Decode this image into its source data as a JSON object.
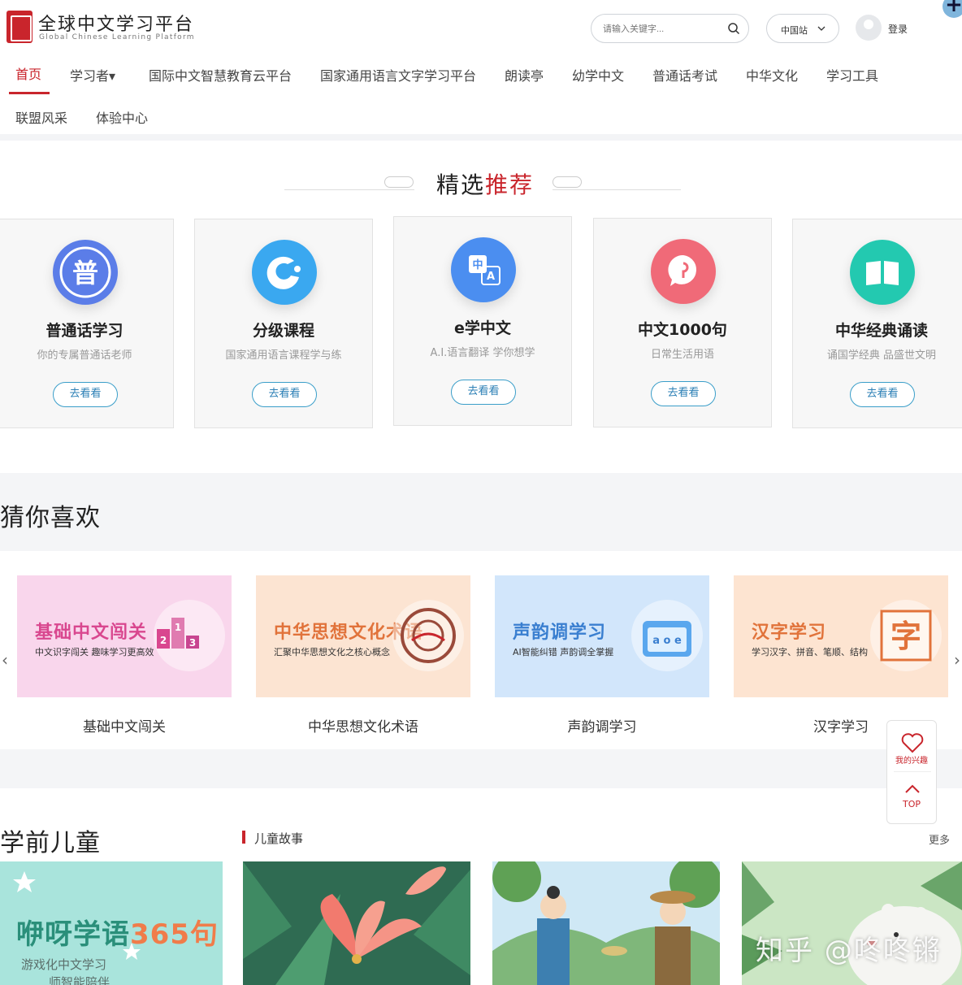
{
  "header": {
    "logo_title": "全球中文学习平台",
    "logo_subtitle": "Global Chinese Learning Platform",
    "search_placeholder": "请输入关键字...",
    "site_select": "中国站",
    "login": "登录"
  },
  "nav": {
    "items": [
      "首页",
      "学习者▾",
      "国际中文智慧教育云平台",
      "国家通用语言文字学习平台",
      "朗读亭",
      "幼学中文",
      "普通话考试",
      "中华文化",
      "学习工具",
      "联盟风采",
      "体验中心"
    ],
    "active": "首页"
  },
  "featured": {
    "title_black": "精选",
    "title_red": "推荐",
    "cards": [
      {
        "title": "普通话学习",
        "subtitle": "你的专属普通话老师",
        "button": "去看看",
        "icon": "pu-character-icon",
        "color": "#5b7de8"
      },
      {
        "title": "分级课程",
        "subtitle": "国家通用语言课程学与练",
        "button": "去看看",
        "icon": "whale-icon",
        "color": "#3aa8f0"
      },
      {
        "title": "e学中文",
        "subtitle": "A.I.语言翻译 学你想学",
        "button": "去看看",
        "icon": "translate-icon",
        "color": "#4b8ef0"
      },
      {
        "title": "中文1000句",
        "subtitle": "日常生活用语",
        "button": "去看看",
        "icon": "speech-bubble-icon",
        "color": "#f06a78"
      },
      {
        "title": "中华经典诵读",
        "subtitle": "诵国学经典 品盛世文明",
        "button": "去看看",
        "icon": "book-icon",
        "color": "#23c9b0"
      }
    ]
  },
  "guess": {
    "title": "猜你喜欢",
    "items": [
      {
        "banner_title": "基础中文闯关",
        "banner_sub": "中文识字闯关 趣味学习更高效",
        "label": "基础中文闯关",
        "title_color": "#d9478f",
        "bg": "#f9d6ec"
      },
      {
        "banner_title": "中华思想文化术语",
        "banner_sub": "汇聚中华思想文化之核心概念",
        "label": "中华思想文化术语",
        "title_color": "#e1733b",
        "bg": "#fce4d2"
      },
      {
        "banner_title": "声韵调学习",
        "banner_sub": "AI智能纠错  声韵调全掌握",
        "label": "声韵调学习",
        "title_color": "#3a7fd0",
        "bg": "#d2e6fb",
        "icon_text": "a o e"
      },
      {
        "banner_title": "汉字学习",
        "banner_sub": "学习汉字、拼音、笔顺、结构",
        "label": "汉字学习",
        "title_color": "#e1733b",
        "bg": "#fde4d1",
        "icon_text": "字"
      }
    ],
    "podium_numbers": [
      "2",
      "1",
      "3"
    ]
  },
  "float_widget": {
    "favorite": "我的兴趣",
    "top": "TOP"
  },
  "preschool": {
    "title": "学前儿童",
    "stories_label": "儿童故事",
    "more": "更多",
    "banner_big": "咿呀学语",
    "banner_big_num": "365句",
    "banner_line1": "游戏化中文学习",
    "banner_line2": "师智能陪伴"
  },
  "watermark": "知乎 @咚咚锵"
}
